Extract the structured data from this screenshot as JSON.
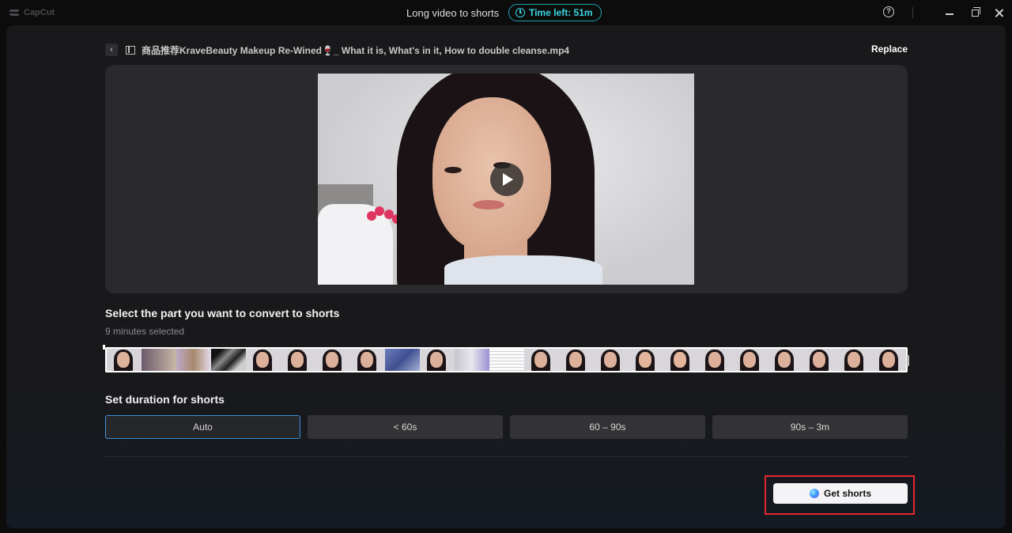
{
  "app": {
    "logo_text": "CapCut",
    "title": "Long video to shorts",
    "time_left": "Time left: 51m"
  },
  "file": {
    "name": "商品推荐KraveBeauty Makeup Re-Wined🍷_ What it is, What's in it, How to double cleanse.mp4",
    "replace_label": "Replace"
  },
  "selection": {
    "title": "Select the part you want to convert to shorts",
    "selected_text": "9 minutes selected"
  },
  "duration": {
    "title": "Set duration for shorts",
    "options": [
      "Auto",
      "< 60s",
      "60 – 90s",
      "90s – 3m"
    ],
    "selected": "Auto"
  },
  "action": {
    "get_shorts_label": "Get shorts"
  },
  "colors": {
    "accent_cyan": "#38d6e0",
    "selected_border": "#3a8fd9",
    "highlight_red": "#e3262b"
  }
}
